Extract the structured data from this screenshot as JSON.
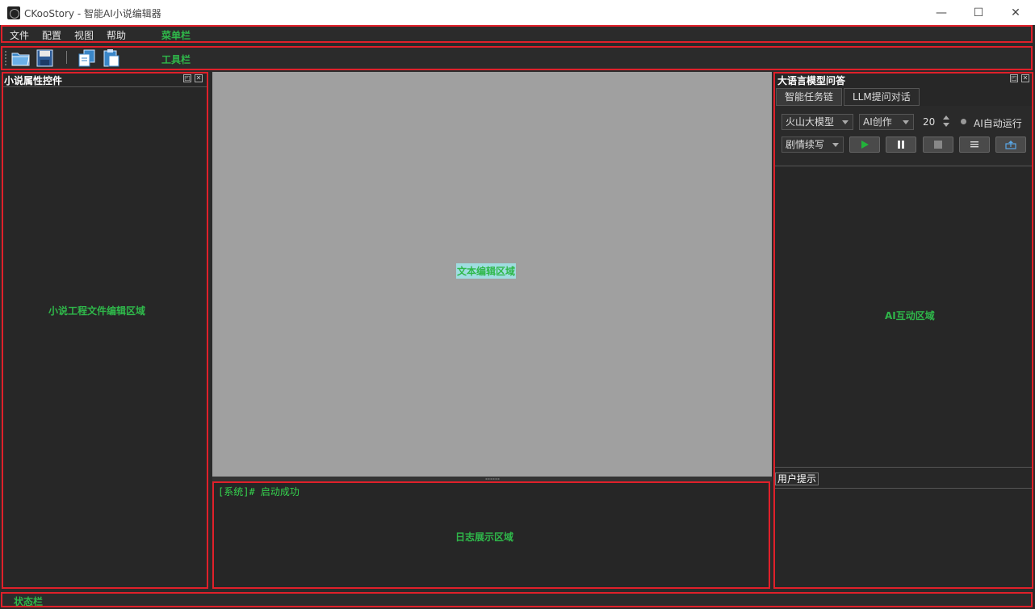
{
  "window": {
    "title": "CKooStory - 智能AI小说编辑器",
    "minimize": "—",
    "maximize": "☐",
    "close": "✕"
  },
  "menubar": {
    "items": [
      "文件",
      "配置",
      "视图",
      "帮助"
    ],
    "caption": "菜单栏"
  },
  "toolbar": {
    "caption": "工具栏",
    "buttons": [
      "open-folder-icon",
      "save-icon",
      "copy-icon",
      "paste-icon"
    ]
  },
  "left_panel": {
    "title": "小说属性控件",
    "caption": "小说工程文件编辑区域"
  },
  "editor": {
    "caption": "文本编辑区域"
  },
  "log": {
    "line": "[系统]# 启动成功",
    "caption": "日志展示区域"
  },
  "right_panel": {
    "title": "大语言模型问答",
    "tabs": [
      "智能任务链",
      "LLM提问对话"
    ],
    "model_select": "火山大模型",
    "mode_select": "AI创作",
    "count": "20",
    "auto_run": "AI自动运行",
    "task_select": "剧情续写",
    "action_buttons": [
      "play-icon",
      "pause-icon",
      "stop-icon",
      "list-icon",
      "cloud-upload-icon"
    ],
    "ai_caption": "AI互动区域",
    "hint_label": "用户提示"
  },
  "statusbar": {
    "caption": "状态栏"
  },
  "colors": {
    "outline": "#e0202a",
    "caption_green": "#2fb84a",
    "log_green": "#35d44e",
    "editor_bg": "#a0a0a0"
  }
}
